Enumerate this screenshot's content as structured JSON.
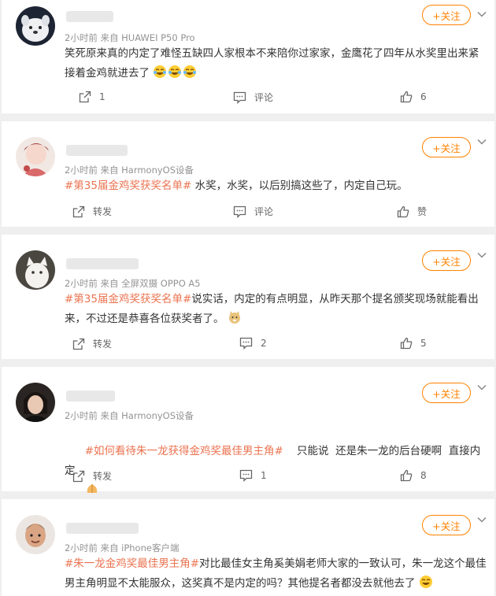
{
  "follow_label": "+关注",
  "comments": [
    {
      "meta": "2小时前  来自 HUAWEI P50 Pro",
      "tag": "",
      "text": "笑死原来真的内定了难怪五缺四人家根本不来陪你过家家，金鹰花了四年从水奖里出来紧接着金鸡就进去了",
      "emoji": "[笑cry][笑cry][笑cry]",
      "share": "1",
      "comment": "评论",
      "like": "6"
    },
    {
      "meta": "2小时前  来自 HarmonyOS设备",
      "tag": "#第35届金鸡奖获奖名单#",
      "text": " 水奖，水奖，以后别搞这些了，内定自己玩。",
      "emoji": "",
      "share": "转发",
      "comment": "评论",
      "like": "赞"
    },
    {
      "meta": "2小时前  来自 全屏双摄 OPPO A5",
      "tag": "#第35届金鸡奖获奖名单#",
      "text": "说实话，内定的有点明显，从昨天那个提名颁奖现场就能看出来，不过还是恭喜各位获奖者了。",
      "emoji": "[doge]",
      "share": "转发",
      "comment": "2",
      "like": "5"
    },
    {
      "meta": "2小时前  来自 HarmonyOS设备",
      "tag": "#如何看待朱一龙获得金鸡奖最佳男主角#",
      "text": "    只能说  还是朱一龙的后台硬啊  直接内定",
      "emoji": "[抱拳]",
      "share": "转发",
      "comment": "1",
      "like": "8"
    },
    {
      "meta": "2小时前  来自 iPhone客户端",
      "tag": "#朱一龙金鸡奖最佳男主角#",
      "text": "对比最佳女主角奚美娟老师大家的一致认可，朱一龙这个最佳男主角明显不太能服众，这奖真不是内定的吗？其他提名者都没去就他去了",
      "emoji": "[哈哈]",
      "share": "",
      "comment": "",
      "like": ""
    }
  ]
}
